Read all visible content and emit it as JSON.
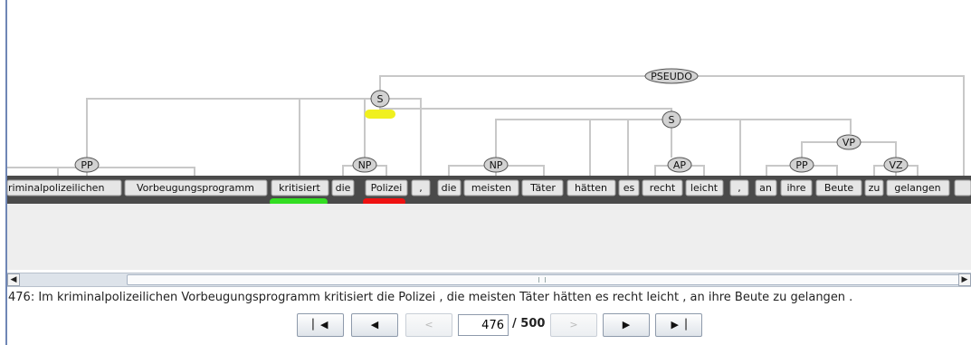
{
  "tree": {
    "nodes": {
      "pseudo": "PSEUDO",
      "s_main": "S",
      "s_sub": "S",
      "vp": "VP",
      "pp1": "PP",
      "np1": "NP",
      "np2": "NP",
      "ap": "AP",
      "pp2": "PP",
      "vz": "VZ"
    },
    "tokens": [
      "riminalpolizeilichen",
      "Vorbeugungsprogramm",
      "kritisiert",
      "die",
      "Polizei",
      ",",
      "die",
      "meisten",
      "Täter",
      "hätten",
      "es",
      "recht",
      "leicht",
      ",",
      "an",
      "ihre",
      "Beute",
      "zu",
      "gelangen",
      ""
    ],
    "highlights": {
      "yellow": "#f0f01e",
      "green": "#33dd22",
      "red": "#ee1111"
    }
  },
  "scrollbar": {
    "left_icon": "left-arrow-icon",
    "right_icon": "right-arrow-icon"
  },
  "sentence": "476: Im kriminalpolizeilichen Vorbeugungsprogramm kritisiert die Polizei , die meisten Täter hätten es recht leicht , an ihre Beute zu gelangen .",
  "nav": {
    "first_icon": "first-page-icon",
    "prev_icon": "previous-page-icon",
    "prev_small": "<",
    "page_value": "476",
    "page_total": "/ 500",
    "next_small": ">",
    "next_icon": "next-page-icon",
    "last_icon": "last-page-icon"
  }
}
